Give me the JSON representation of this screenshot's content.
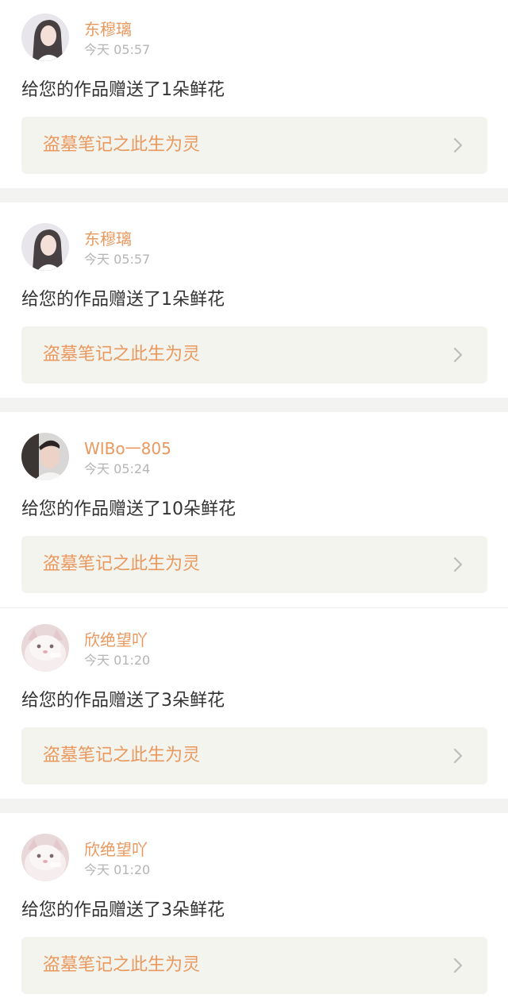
{
  "theme": {
    "accent": "#e9985e",
    "work_link_bg": "#f4f4ef",
    "chevron": "#bcbcbc"
  },
  "notifications": [
    {
      "username": "东穆璃",
      "time": "今天 05:57",
      "message": "给您的作品赠送了1朵鲜花",
      "work_title": "盗墓笔记之此生为灵",
      "avatar_icon": "woman-portrait-avatar"
    },
    {
      "username": "东穆璃",
      "time": "今天 05:57",
      "message": "给您的作品赠送了1朵鲜花",
      "work_title": "盗墓笔记之此生为灵",
      "avatar_icon": "woman-portrait-avatar"
    },
    {
      "username": "WIBo一805",
      "time": "今天 05:24",
      "message": "给您的作品赠送了10朵鲜花",
      "work_title": "盗墓笔记之此生为灵",
      "avatar_icon": "man-portrait-avatar"
    },
    {
      "username": "欣绝望吖",
      "time": "今天 01:20",
      "message": "给您的作品赠送了3朵鲜花",
      "work_title": "盗墓笔记之此生为灵",
      "avatar_icon": "cat-avatar"
    },
    {
      "username": "欣绝望吖",
      "time": "今天 01:20",
      "message": "给您的作品赠送了3朵鲜花",
      "work_title": "盗墓笔记之此生为灵",
      "avatar_icon": "cat-avatar"
    }
  ]
}
